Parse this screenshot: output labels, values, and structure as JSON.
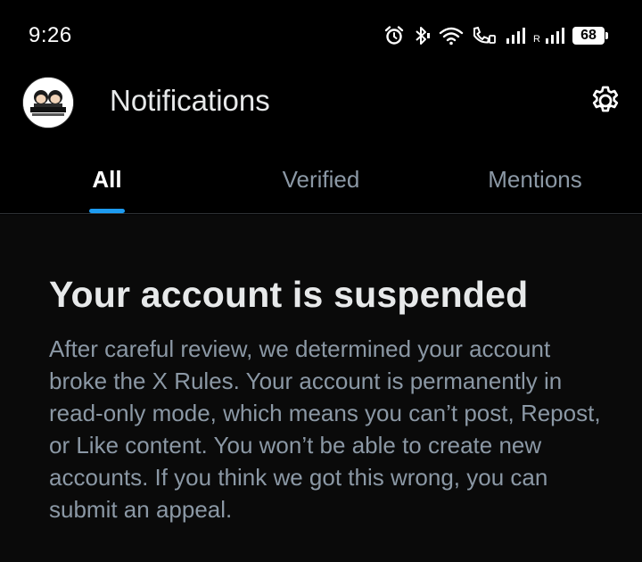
{
  "status_bar": {
    "time": "9:26",
    "roaming": "R",
    "battery": "68",
    "icons": [
      "alarm-icon",
      "bluetooth-icon",
      "wifi-icon",
      "volte-call-icon",
      "signal-icon",
      "signal-roaming-icon",
      "battery-icon"
    ]
  },
  "header": {
    "title": "Notifications",
    "avatar_icon": "profile-avatar",
    "settings_icon": "gear-icon"
  },
  "tabs": [
    {
      "label": "All",
      "active": true
    },
    {
      "label": "Verified",
      "active": false
    },
    {
      "label": "Mentions",
      "active": false
    }
  ],
  "notice": {
    "title": "Your account is suspended",
    "body": "After careful review, we determined your account broke the X Rules. Your account is permanently in read-only mode, which means you can’t post, Repost, or Like content. You won’t be able to create new accounts. If you think we got this wrong, you can submit an appeal."
  },
  "colors": {
    "background": "#000000",
    "accent": "#1d9bf0",
    "text_primary": "#e7e9ea",
    "text_secondary": "#8b98a5"
  }
}
